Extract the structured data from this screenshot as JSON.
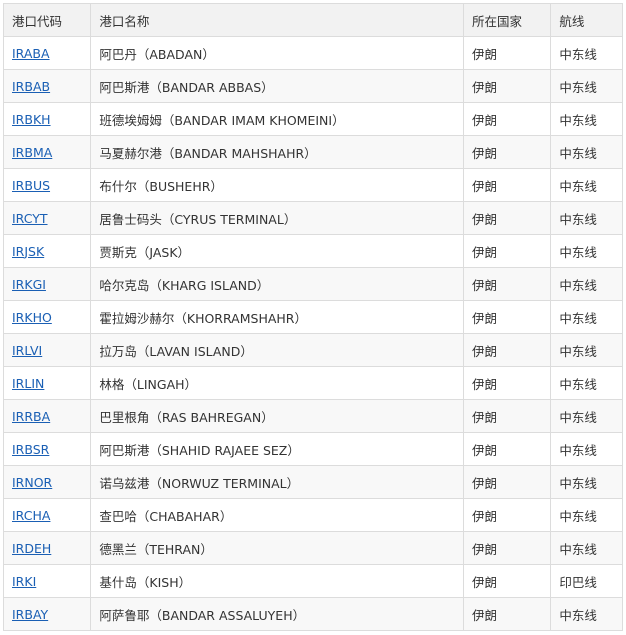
{
  "table": {
    "headers": [
      "港口代码",
      "港口名称",
      "所在国家",
      "航线"
    ],
    "rows": [
      {
        "code": "IRABA",
        "name": "阿巴丹（ABADAN）",
        "country": "伊朗",
        "route": "中东线"
      },
      {
        "code": "IRBAB",
        "name": "阿巴斯港（BANDAR ABBAS）",
        "country": "伊朗",
        "route": "中东线"
      },
      {
        "code": "IRBKH",
        "name": "班德埃姆姆（BANDAR IMAM KHOMEINI）",
        "country": "伊朗",
        "route": "中东线"
      },
      {
        "code": "IRBMA",
        "name": "马夏赫尔港（BANDAR MAHSHAHR）",
        "country": "伊朗",
        "route": "中东线"
      },
      {
        "code": "IRBUS",
        "name": "布什尔（BUSHEHR）",
        "country": "伊朗",
        "route": "中东线"
      },
      {
        "code": "IRCYT",
        "name": "居鲁士码头（CYRUS TERMINAL）",
        "country": "伊朗",
        "route": "中东线"
      },
      {
        "code": "IRJSK",
        "name": "贾斯克（JASK）",
        "country": "伊朗",
        "route": "中东线"
      },
      {
        "code": "IRKGI",
        "name": "哈尔克岛（KHARG ISLAND）",
        "country": "伊朗",
        "route": "中东线"
      },
      {
        "code": "IRKHO",
        "name": "霍拉姆沙赫尔（KHORRAMSHAHR）",
        "country": "伊朗",
        "route": "中东线"
      },
      {
        "code": "IRLVI",
        "name": "拉万岛（LAVAN ISLAND）",
        "country": "伊朗",
        "route": "中东线"
      },
      {
        "code": "IRLIN",
        "name": "林格（LINGAH）",
        "country": "伊朗",
        "route": "中东线"
      },
      {
        "code": "IRRBA",
        "name": "巴里根角（RAS BAHREGAN）",
        "country": "伊朗",
        "route": "中东线"
      },
      {
        "code": "IRBSR",
        "name": "阿巴斯港（SHAHID RAJAEE SEZ）",
        "country": "伊朗",
        "route": "中东线"
      },
      {
        "code": "IRNOR",
        "name": "诺乌兹港（NORWUZ TERMINAL）",
        "country": "伊朗",
        "route": "中东线"
      },
      {
        "code": "IRCHA",
        "name": "查巴哈（CHABAHAR）",
        "country": "伊朗",
        "route": "中东线"
      },
      {
        "code": "IRDEH",
        "name": "德黑兰（TEHRAN）",
        "country": "伊朗",
        "route": "中东线"
      },
      {
        "code": "IRKI",
        "name": "基什岛（KISH）",
        "country": "伊朗",
        "route": "印巴线"
      },
      {
        "code": "IRBAY",
        "name": "阿萨鲁耶（BANDAR ASSALUYEH）",
        "country": "伊朗",
        "route": "中东线"
      }
    ]
  }
}
